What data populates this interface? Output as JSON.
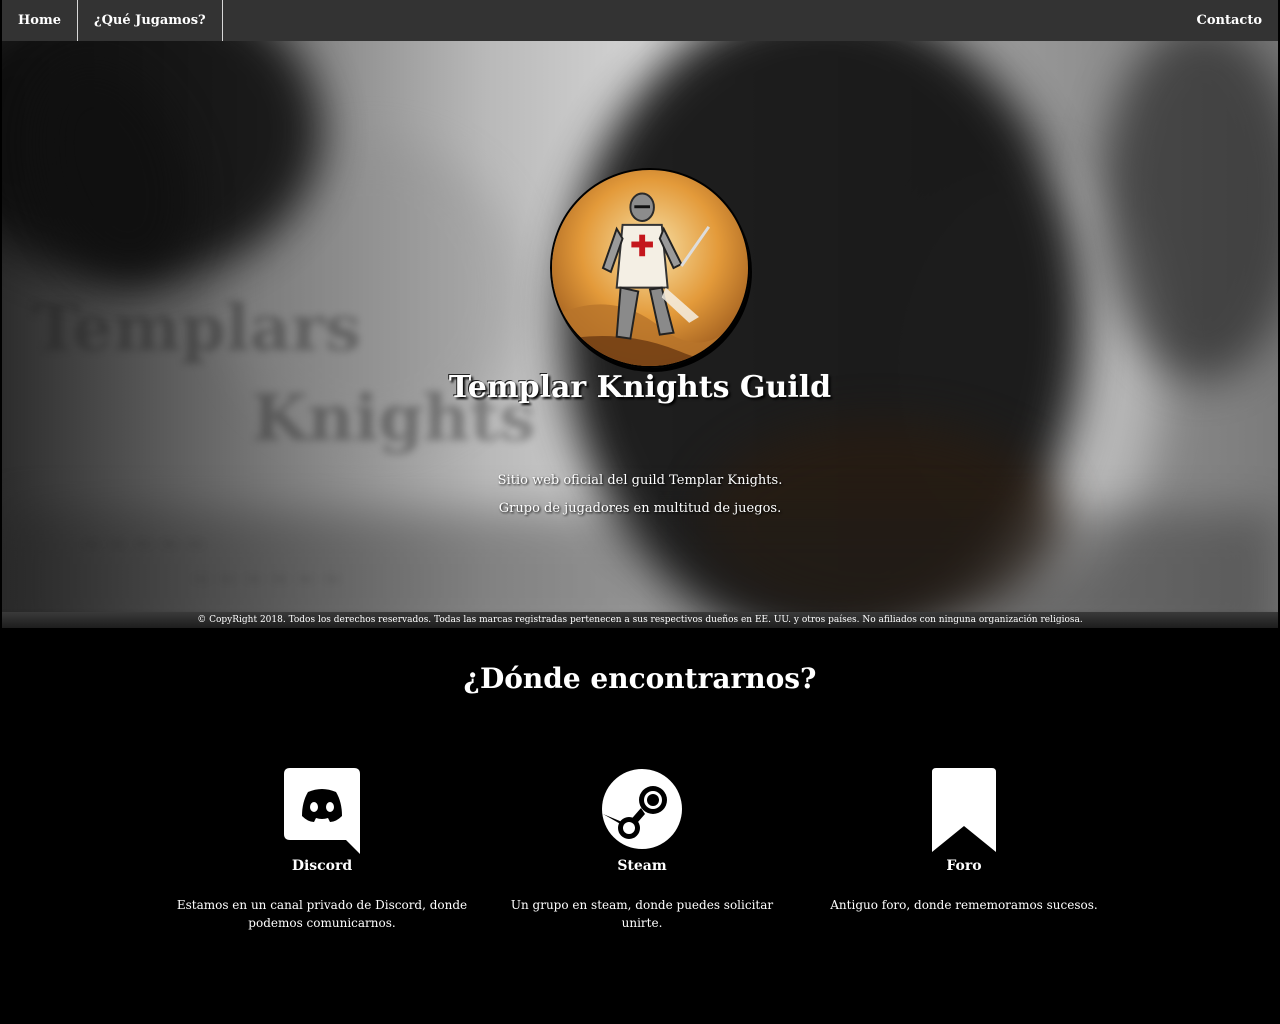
{
  "nav": {
    "home": "Home",
    "what_we_play": "¿Qué Jugamos?",
    "contact": "Contacto"
  },
  "hero": {
    "title": "Templar Knights Guild",
    "subtitle": "Sitio web oficial del guild Templar Knights. Grupo de jugadores en multitud de juegos.",
    "avatar_icon": "templar-knight-avatar"
  },
  "copyright": "© CopyRight 2018. Todos los derechos reservados. Todas las marcas registradas pertenecen a sus respectivos dueños en EE. UU. y otros países. No afiliados con ninguna organización religiosa.",
  "find_us": {
    "title": "¿Dónde encontrarnos?",
    "cards": [
      {
        "icon": "discord-icon",
        "label": "Discord",
        "description": "Estamos en un canal privado de Discord, donde podemos comunicarnos."
      },
      {
        "icon": "steam-icon",
        "label": "Steam",
        "description": "Un grupo en steam, donde puedes solicitar unirte."
      },
      {
        "icon": "bookmark-icon",
        "label": "Foro",
        "description": "Antiguo foro, donde rememoramos sucesos."
      }
    ]
  },
  "colors": {
    "nav_bg": "#333333",
    "page_bg": "#000000",
    "text": "#ffffff"
  }
}
